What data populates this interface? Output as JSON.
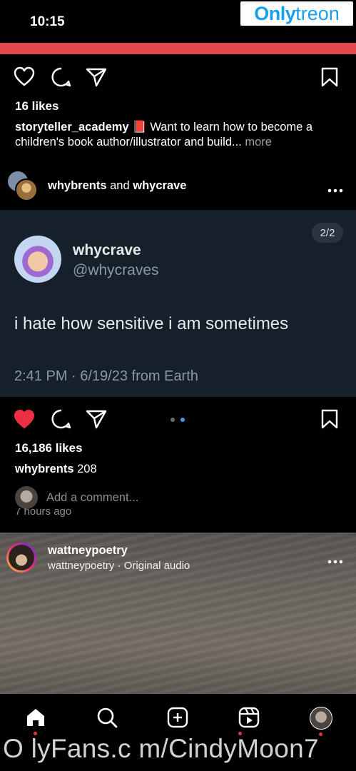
{
  "status_bar": {
    "time": "10:15"
  },
  "watermark_top": {
    "part1": "Only",
    "part2": "treon"
  },
  "post1": {
    "likes": "16 likes",
    "caption_user": "storyteller_academy",
    "caption_emoji": "📕",
    "caption_text": "Want to learn how to become a children's book author/illustrator and build...",
    "more_label": "more"
  },
  "post2": {
    "header_user1": "whybrents",
    "header_and": "and",
    "header_user2": "whycrave",
    "tweet": {
      "page_indicator": "2/2",
      "name": "whycrave",
      "handle": "@whycraves",
      "text": "i hate how sensitive i am sometimes",
      "meta": "2:41 PM · 6/19/23 from Earth"
    },
    "likes": "16,186 likes",
    "comment_user": "whybrents",
    "comment_text": "208",
    "add_comment_placeholder": "Add a comment...",
    "time_ago": "7 hours ago",
    "liked_color": "#ed2f43"
  },
  "post3": {
    "username": "wattneypoetry",
    "subtitle": "wattneypoetry · Original audio"
  },
  "footer_watermark": "O lyFans.c m/CindyMoon7",
  "colors": {
    "accent_red": "#e5474f",
    "tweet_bg": "#15202b",
    "muted": "#9aa0a6"
  }
}
